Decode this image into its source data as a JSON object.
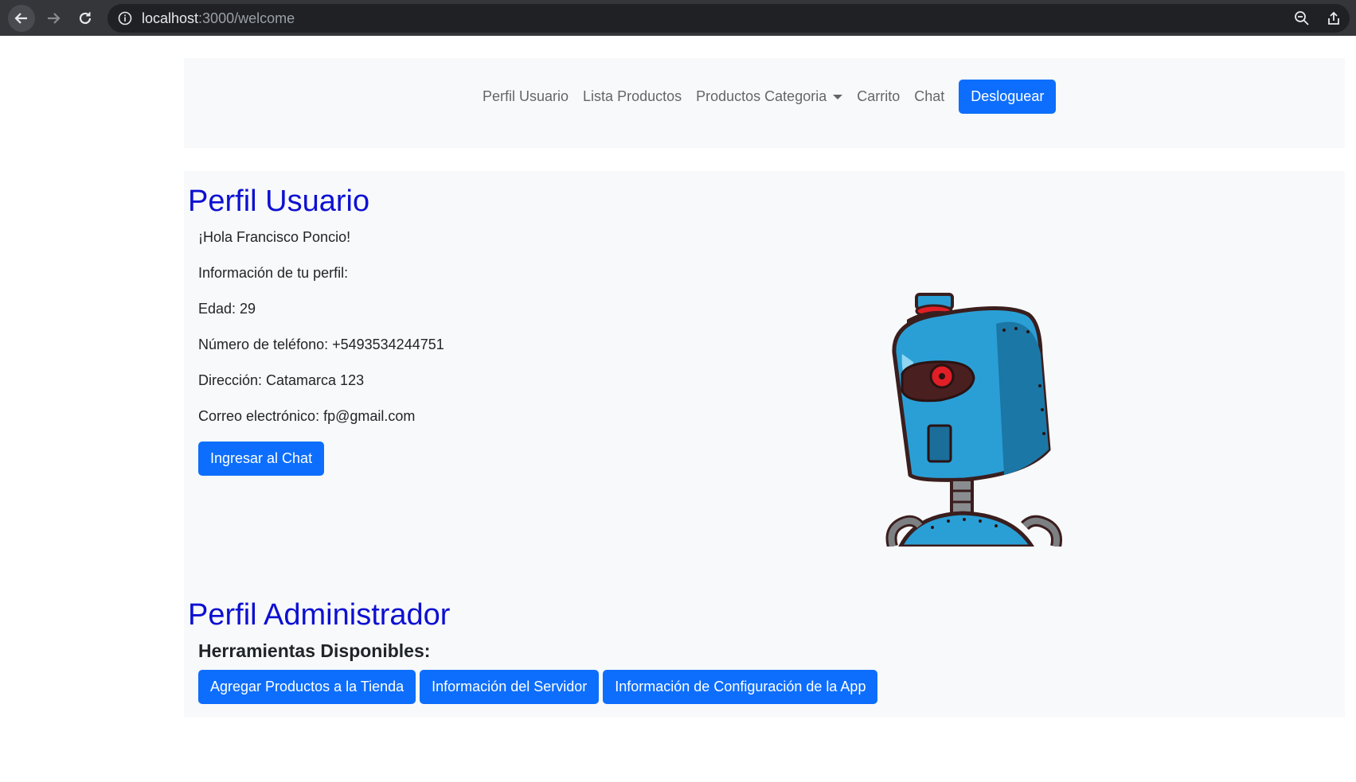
{
  "browser": {
    "url_host": "localhost",
    "url_path": ":3000/welcome"
  },
  "navbar": {
    "links": [
      "Perfil Usuario",
      "Lista Productos",
      "Productos Categoria",
      "Carrito",
      "Chat"
    ],
    "logout_label": "Desloguear"
  },
  "user_profile": {
    "title": "Perfil Usuario",
    "greeting": "¡Hola Francisco Poncio!",
    "info_heading": "Información de tu perfil:",
    "age": "Edad: 29",
    "phone": "Número de teléfono: +5493534244751",
    "address": "Dirección: Catamarca 123",
    "email": "Correo electrónico: fp@gmail.com",
    "chat_button": "Ingresar al Chat"
  },
  "admin_profile": {
    "title": "Perfil Administrador",
    "tools_heading": "Herramientas Disponibles:",
    "buttons": [
      "Agregar Productos a la Tienda",
      "Información del Servidor",
      "Información de Configuración de la App"
    ]
  },
  "colors": {
    "primary_button": "#0d6efd",
    "title": "#0d10d1",
    "panel_bg": "#f8f9fa"
  },
  "icons": [
    "back-arrow-icon",
    "forward-arrow-icon",
    "reload-icon",
    "info-icon",
    "zoom-icon",
    "share-icon",
    "robot-illustration"
  ]
}
